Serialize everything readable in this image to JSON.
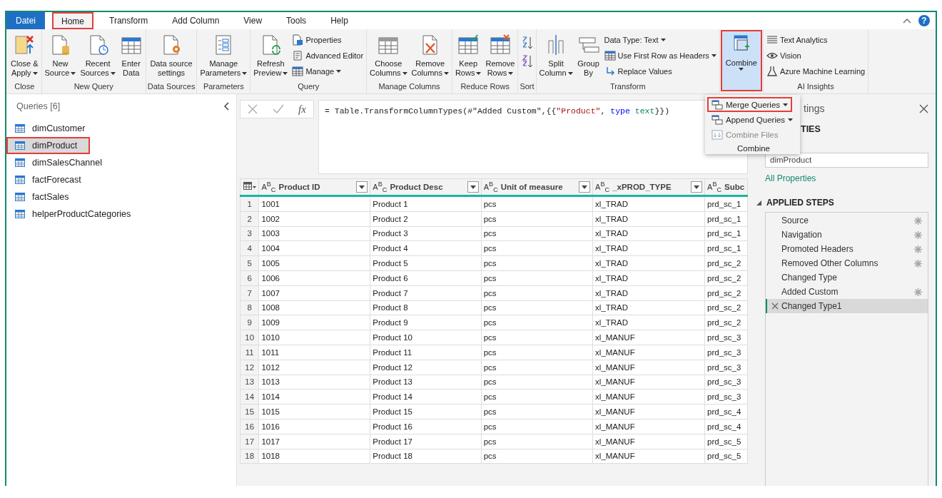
{
  "tabs": [
    {
      "label": "Datei",
      "kind": "file",
      "selected": false,
      "highlighted": false
    },
    {
      "label": "Home",
      "kind": "tab",
      "selected": true,
      "highlighted": true
    },
    {
      "label": "Transform",
      "kind": "tab",
      "selected": false,
      "highlighted": false
    },
    {
      "label": "Add Column",
      "kind": "tab",
      "selected": false,
      "highlighted": false
    },
    {
      "label": "View",
      "kind": "tab",
      "selected": false,
      "highlighted": false
    },
    {
      "label": "Tools",
      "kind": "tab",
      "selected": false,
      "highlighted": false
    },
    {
      "label": "Help",
      "kind": "tab",
      "selected": false,
      "highlighted": false
    }
  ],
  "help": "?",
  "ribbon": {
    "groups": [
      {
        "label": "Close",
        "items": [
          {
            "kind": "large",
            "lines": [
              "Close &",
              "Apply"
            ],
            "dropdown": true,
            "pressed": false,
            "highlighted": false
          }
        ]
      },
      {
        "label": "New Query",
        "items": [
          {
            "kind": "large",
            "lines": [
              "New",
              "Source"
            ],
            "dropdown": true,
            "pressed": false,
            "highlighted": false
          },
          {
            "kind": "large",
            "lines": [
              "Recent",
              "Sources"
            ],
            "dropdown": true,
            "pressed": false,
            "highlighted": false
          },
          {
            "kind": "large",
            "lines": [
              "Enter",
              "Data"
            ],
            "dropdown": false,
            "pressed": false,
            "highlighted": false
          }
        ]
      },
      {
        "label": "Data Sources",
        "items": [
          {
            "kind": "large",
            "lines": [
              "Data source",
              "settings"
            ],
            "dropdown": false,
            "pressed": false,
            "highlighted": false
          }
        ]
      },
      {
        "label": "Parameters",
        "items": [
          {
            "kind": "large",
            "lines": [
              "Manage",
              "Parameters"
            ],
            "dropdown": true,
            "pressed": false,
            "highlighted": false
          }
        ]
      },
      {
        "label": "Query",
        "items": [
          {
            "kind": "large",
            "lines": [
              "Refresh",
              "Preview"
            ],
            "dropdown": true,
            "pressed": false,
            "highlighted": false
          },
          {
            "kind": "stack",
            "entries": [
              {
                "label": "Properties",
                "dropdown": false
              },
              {
                "label": "Advanced Editor",
                "dropdown": false
              },
              {
                "label": "Manage",
                "dropdown": true
              }
            ]
          }
        ]
      },
      {
        "label": "Manage Columns",
        "items": [
          {
            "kind": "large",
            "lines": [
              "Choose",
              "Columns"
            ],
            "dropdown": true,
            "pressed": false,
            "highlighted": false
          },
          {
            "kind": "large",
            "lines": [
              "Remove",
              "Columns"
            ],
            "dropdown": true,
            "pressed": false,
            "highlighted": false
          }
        ]
      },
      {
        "label": "Reduce Rows",
        "items": [
          {
            "kind": "large",
            "lines": [
              "Keep",
              "Rows"
            ],
            "dropdown": true,
            "pressed": false,
            "highlighted": false
          },
          {
            "kind": "large",
            "lines": [
              "Remove",
              "Rows"
            ],
            "dropdown": true,
            "pressed": false,
            "highlighted": false
          }
        ]
      },
      {
        "label": "Sort",
        "items": [
          {
            "kind": "sort"
          }
        ]
      },
      {
        "label": "Transform",
        "items": [
          {
            "kind": "large",
            "lines": [
              "Split",
              "Column"
            ],
            "dropdown": true,
            "pressed": false,
            "highlighted": false
          },
          {
            "kind": "large",
            "lines": [
              "Group",
              "By"
            ],
            "dropdown": false,
            "pressed": false,
            "highlighted": false
          },
          {
            "kind": "stack",
            "entries": [
              {
                "label": "Data Type: Text",
                "dropdown": true
              },
              {
                "label": "Use First Row as Headers",
                "dropdown": true
              },
              {
                "label": "Replace Values",
                "dropdown": false
              }
            ]
          }
        ]
      },
      {
        "items": [
          {
            "kind": "large",
            "lines": [
              "Combine"
            ],
            "dropdown": true,
            "pressed": true,
            "highlighted": true
          }
        ]
      },
      {
        "label": "AI Insights",
        "items": [
          {
            "kind": "stack",
            "entries": [
              {
                "label": "Text Analytics",
                "dropdown": false
              },
              {
                "label": "Vision",
                "dropdown": false
              },
              {
                "label": "Azure Machine Learning",
                "dropdown": false
              }
            ]
          }
        ]
      }
    ]
  },
  "combine_menu": {
    "items": [
      {
        "label": "Merge Queries",
        "dropdown": true,
        "disabled": false,
        "highlighted": true
      },
      {
        "label": "Append Queries",
        "dropdown": true,
        "disabled": false,
        "highlighted": false
      },
      {
        "label": "Combine Files",
        "dropdown": false,
        "disabled": true,
        "highlighted": false
      }
    ],
    "title": "Combine"
  },
  "queries": {
    "title": "Queries [6]",
    "items": [
      {
        "label": "dimCustomer",
        "selected": false,
        "highlighted": false
      },
      {
        "label": "dimProduct",
        "selected": true,
        "highlighted": true
      },
      {
        "label": "dimSalesChannel",
        "selected": false,
        "highlighted": false
      },
      {
        "label": "factForecast",
        "selected": false,
        "highlighted": false
      },
      {
        "label": "factSales",
        "selected": false,
        "highlighted": false
      },
      {
        "label": "helperProductCategories",
        "selected": false,
        "highlighted": false
      }
    ]
  },
  "formula_bar": {
    "fx": "fx",
    "tokens": [
      {
        "text": "= Table.TransformColumnTypes(#\"Added Custom\",{{",
        "kind": "plain"
      },
      {
        "text": "\"Product\"",
        "kind": "string"
      },
      {
        "text": ", ",
        "kind": "plain"
      },
      {
        "text": "type",
        "kind": "keyword"
      },
      {
        "text": " text",
        "kind": "typename"
      },
      {
        "text": "}})",
        "kind": "plain"
      }
    ]
  },
  "table": {
    "columns": [
      {
        "type": "A$^{B}$$_{C}$",
        "name": "Product ID"
      },
      {
        "type": "A$^{B}$$_{C}$",
        "name": "Product Desc"
      },
      {
        "type": "A$^{B}$$_{C}$",
        "name": "Unit of measure"
      },
      {
        "type": "A$^{B}$$_{C}$",
        "name": "_xPROD_TYPE"
      },
      {
        "type": "A$^{B}$$_{C}$",
        "name": "Subc"
      }
    ],
    "rows": [
      {
        "num": "1",
        "cells": [
          "1001",
          "Product 1",
          "pcs",
          "xl_TRAD",
          "prd_sc_1"
        ]
      },
      {
        "num": "2",
        "cells": [
          "1002",
          "Product 2",
          "pcs",
          "xl_TRAD",
          "prd_sc_1"
        ]
      },
      {
        "num": "3",
        "cells": [
          "1003",
          "Product 3",
          "pcs",
          "xl_TRAD",
          "prd_sc_1"
        ]
      },
      {
        "num": "4",
        "cells": [
          "1004",
          "Product 4",
          "pcs",
          "xl_TRAD",
          "prd_sc_1"
        ]
      },
      {
        "num": "5",
        "cells": [
          "1005",
          "Product 5",
          "pcs",
          "xl_TRAD",
          "prd_sc_2"
        ]
      },
      {
        "num": "6",
        "cells": [
          "1006",
          "Product 6",
          "pcs",
          "xl_TRAD",
          "prd_sc_2"
        ]
      },
      {
        "num": "7",
        "cells": [
          "1007",
          "Product 7",
          "pcs",
          "xl_TRAD",
          "prd_sc_2"
        ]
      },
      {
        "num": "8",
        "cells": [
          "1008",
          "Product 8",
          "pcs",
          "xl_TRAD",
          "prd_sc_2"
        ]
      },
      {
        "num": "9",
        "cells": [
          "1009",
          "Product 9",
          "pcs",
          "xl_TRAD",
          "prd_sc_2"
        ]
      },
      {
        "num": "10",
        "cells": [
          "1010",
          "Product 10",
          "pcs",
          "xl_MANUF",
          "prd_sc_3"
        ]
      },
      {
        "num": "11",
        "cells": [
          "1011",
          "Product 11",
          "pcs",
          "xl_MANUF",
          "prd_sc_3"
        ]
      },
      {
        "num": "12",
        "cells": [
          "1012",
          "Product 12",
          "pcs",
          "xl_MANUF",
          "prd_sc_3"
        ]
      },
      {
        "num": "13",
        "cells": [
          "1013",
          "Product 13",
          "pcs",
          "xl_MANUF",
          "prd_sc_3"
        ]
      },
      {
        "num": "14",
        "cells": [
          "1014",
          "Product 14",
          "pcs",
          "xl_MANUF",
          "prd_sc_3"
        ]
      },
      {
        "num": "15",
        "cells": [
          "1015",
          "Product 15",
          "pcs",
          "xl_MANUF",
          "prd_sc_4"
        ]
      },
      {
        "num": "16",
        "cells": [
          "1016",
          "Product 16",
          "pcs",
          "xl_MANUF",
          "prd_sc_4"
        ]
      },
      {
        "num": "17",
        "cells": [
          "1017",
          "Product 17",
          "pcs",
          "xl_MANUF",
          "prd_sc_5"
        ]
      },
      {
        "num": "18",
        "cells": [
          "1018",
          "Product 18",
          "pcs",
          "xl_MANUF",
          "prd_sc_5"
        ]
      }
    ]
  },
  "settings": {
    "title": "tings",
    "section": "TIES",
    "name_value": "dimProduct",
    "all_properties": "All Properties",
    "steps_title": "APPLIED STEPS",
    "steps": [
      {
        "label": "Source",
        "settings": true,
        "selected": false
      },
      {
        "label": "Navigation",
        "settings": true,
        "selected": false
      },
      {
        "label": "Promoted Headers",
        "settings": true,
        "selected": false
      },
      {
        "label": "Removed Other Columns",
        "settings": true,
        "selected": false
      },
      {
        "label": "Changed Type",
        "settings": false,
        "selected": false
      },
      {
        "label": "Added Custom",
        "settings": true,
        "selected": false
      },
      {
        "label": "Changed Type1",
        "settings": false,
        "selected": true
      }
    ]
  }
}
